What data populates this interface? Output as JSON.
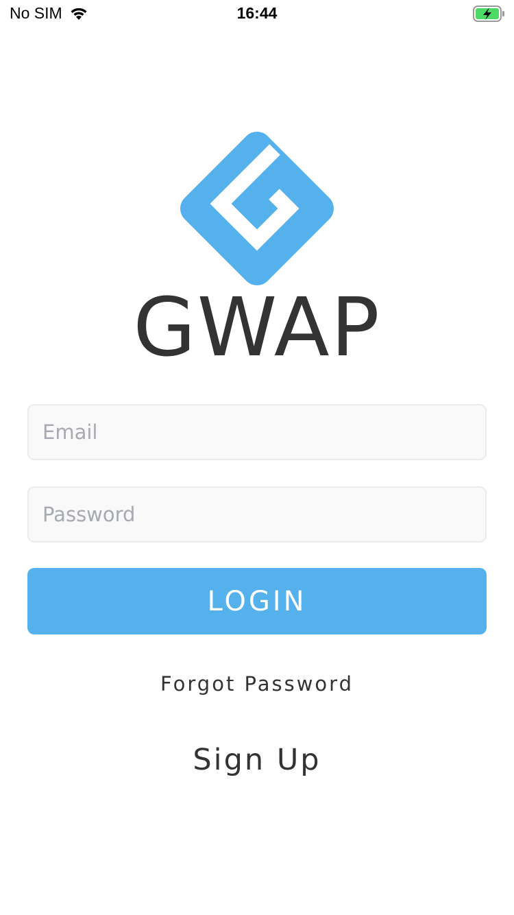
{
  "status_bar": {
    "carrier": "No SIM",
    "time": "16:44"
  },
  "logo": {
    "name": "GWAP",
    "brand_color": "#54b1ec"
  },
  "form": {
    "email_placeholder": "Email",
    "password_placeholder": "Password",
    "login_label": "LOGIN"
  },
  "links": {
    "forgot_password": "Forgot Password",
    "sign_up": "Sign Up"
  },
  "colors": {
    "accent": "#54b1ec",
    "text": "#333333",
    "field_background": "#f9f9f9",
    "battery_charge": "#4cd964"
  }
}
